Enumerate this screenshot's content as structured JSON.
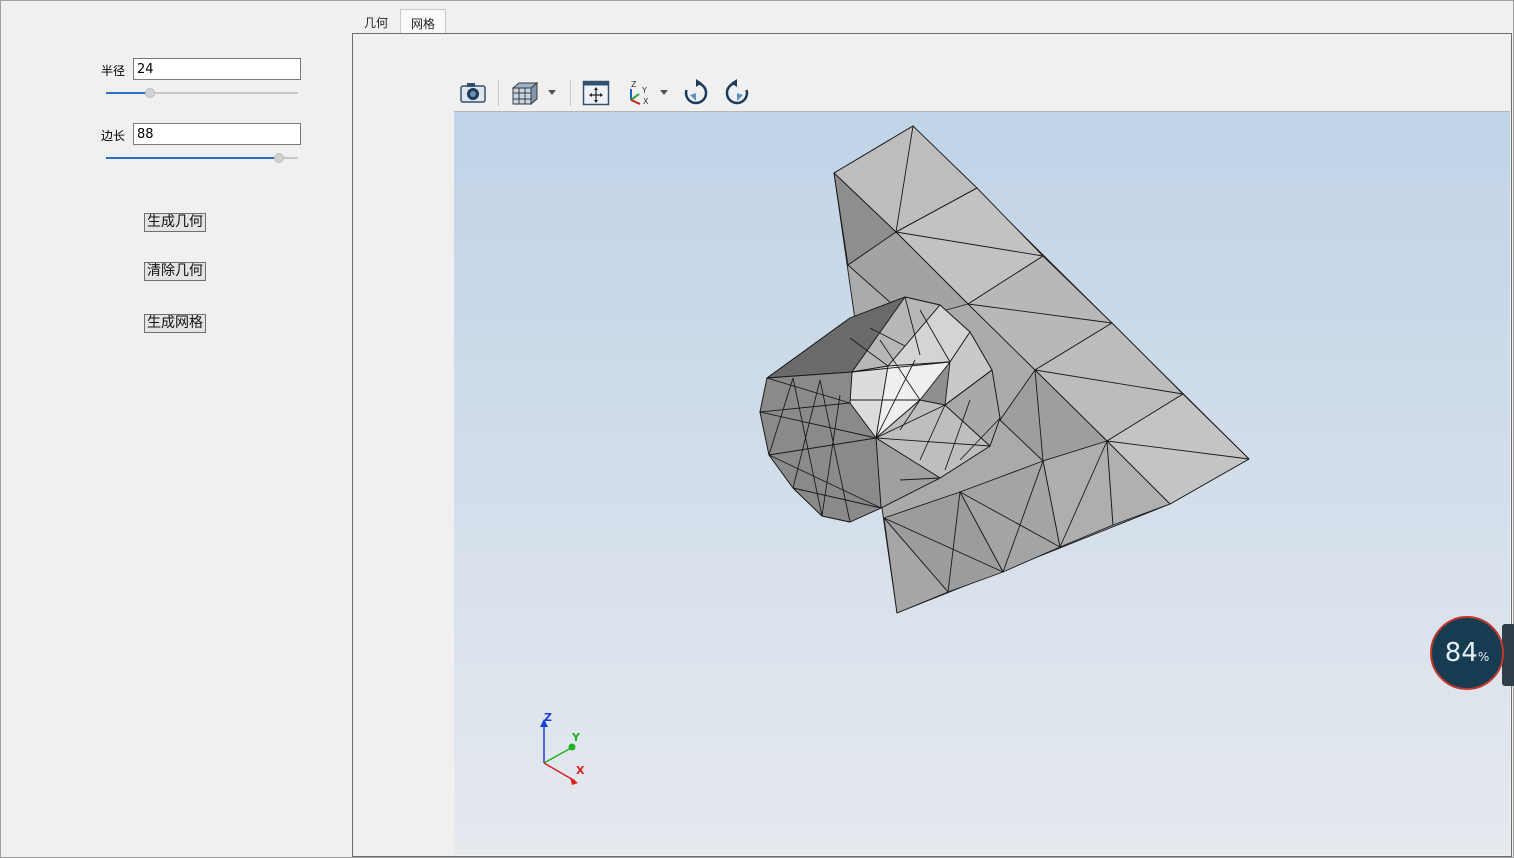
{
  "params": {
    "radius": {
      "label": "半径",
      "value": "24",
      "slider_fraction": 0.23
    },
    "side": {
      "label": "边长",
      "value": "88",
      "slider_fraction": 0.9
    }
  },
  "actions": {
    "generate_geometry": "生成几何",
    "clear_geometry": "清除几何",
    "generate_mesh": "生成网格"
  },
  "tabs": [
    {
      "label": "几何",
      "active": false
    },
    {
      "label": "网格",
      "active": true
    }
  ],
  "toolbar": {
    "icons": [
      "camera-icon",
      "view-cube-icon",
      "fit-view-icon",
      "axes-icon",
      "rotate-cw-icon",
      "rotate-ccw-icon"
    ]
  },
  "axes": {
    "z": "Z",
    "y": "Y",
    "x": "X"
  },
  "gauge": {
    "value": "84",
    "unit": "%"
  },
  "colors": {
    "slider_fill": "#2a72c0",
    "viewport_top": "#bed2e7",
    "viewport_bottom": "#e6e9ee",
    "gauge_bg": "#173c52",
    "gauge_ring": "#c0392b"
  }
}
